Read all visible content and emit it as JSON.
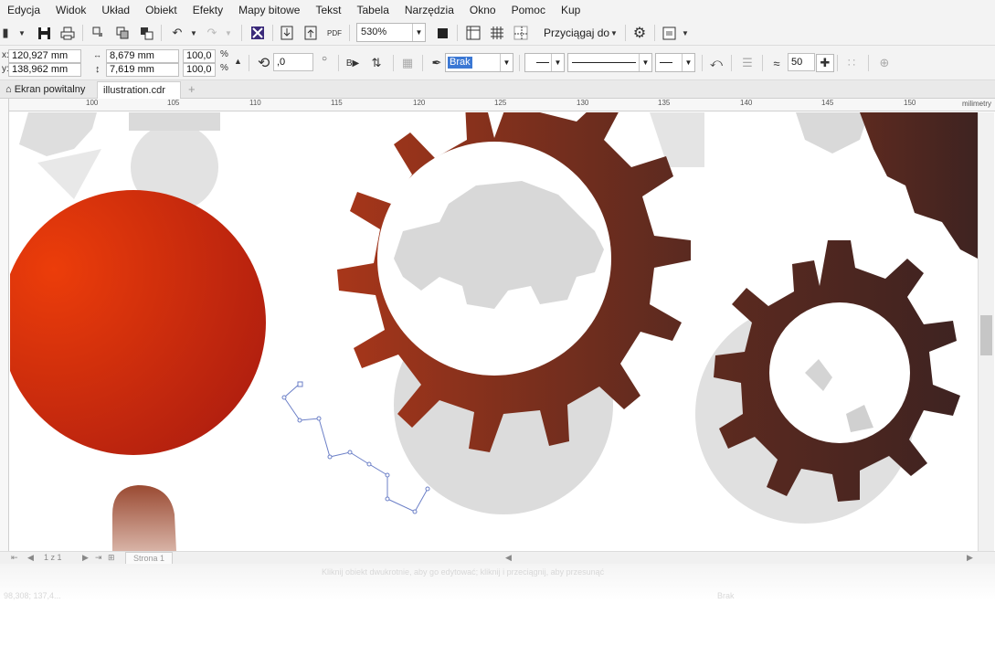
{
  "menu": [
    "Edycja",
    "Widok",
    "Układ",
    "Obiekt",
    "Efekty",
    "Mapy bitowe",
    "Tekst",
    "Tabela",
    "Narzędzia",
    "Okno",
    "Pomoc",
    "Kup"
  ],
  "toolbar": {
    "zoom_value": "530%",
    "snap_label": "Przyciągaj do"
  },
  "propbar": {
    "x_label": "x:",
    "y_label": "y:",
    "x_value": "120,927 mm",
    "y_value": "138,962 mm",
    "width_value": "8,679 mm",
    "height_value": "7,619 mm",
    "scale_x": "100,0",
    "scale_y": "100,0",
    "percent": "%",
    "rotation": ",0",
    "outline_fill": "Brak",
    "smoothing": "50"
  },
  "tabs": {
    "welcome": "Ekran powitalny",
    "document": "illustration.cdr",
    "add": "+"
  },
  "ruler": {
    "ticks": [
      "100",
      "105",
      "110",
      "115",
      "120",
      "125",
      "130",
      "135",
      "140",
      "145",
      "150"
    ],
    "unit": "milimetry"
  },
  "pagenav": {
    "counter": "1 z 1",
    "page_tab": "Strona 1"
  },
  "status": {
    "hint": "Kliknij obiekt dwukrotnie, aby go edytować; kliknij i przeciągnij, aby przesunąć",
    "coords": "98,308; 137,4...",
    "fill": "Brak"
  },
  "colors": {
    "orange_start": "#ec3d0a",
    "orange_end": "#b3200f",
    "brown_start": "#a8361a",
    "brown_mid": "#7a2f1d",
    "brown_end": "#3e2321",
    "grey_gear": "#d8d8d8",
    "selection_blue": "#3b78d4"
  }
}
